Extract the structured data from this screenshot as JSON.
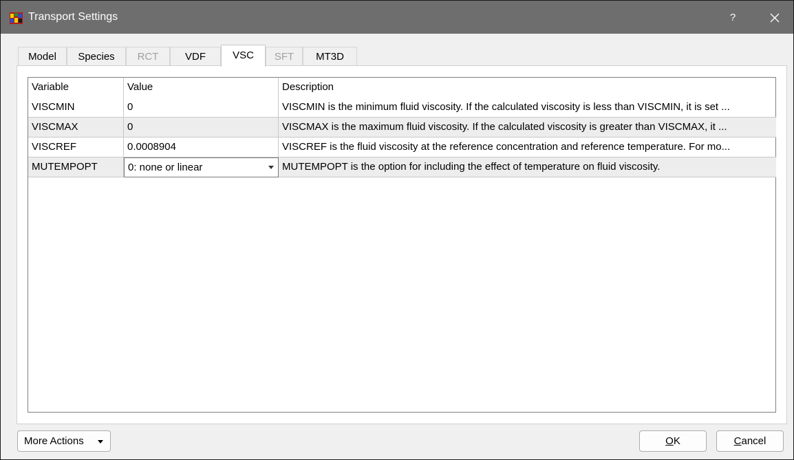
{
  "window": {
    "title": "Transport Settings",
    "help_label": "?",
    "icon": "app-icon",
    "colors": {
      "titlebar": "#6e6e6e",
      "alt_row": "#ededed"
    }
  },
  "tabs": [
    {
      "label": "Model",
      "enabled": true,
      "active": false
    },
    {
      "label": "Species",
      "enabled": true,
      "active": false
    },
    {
      "label": "RCT",
      "enabled": false,
      "active": false
    },
    {
      "label": "VDF",
      "enabled": true,
      "active": false
    },
    {
      "label": "VSC",
      "enabled": true,
      "active": true
    },
    {
      "label": "SFT",
      "enabled": false,
      "active": false
    },
    {
      "label": "MT3D",
      "enabled": true,
      "active": false
    }
  ],
  "table": {
    "columns": [
      "Variable",
      "Value",
      "Description"
    ],
    "rows": [
      {
        "variable": "VISCMIN",
        "value": "0",
        "description": "VISCMIN is the minimum fluid viscosity. If the calculated viscosity is less than VISCMIN, it is set ..."
      },
      {
        "variable": "VISCMAX",
        "value": "0",
        "description": "VISCMAX is the maximum fluid viscosity. If the calculated viscosity is greater than VISCMAX, it ..."
      },
      {
        "variable": "VISCREF",
        "value": "0.0008904",
        "description": "VISCREF is the fluid viscosity at the reference concentration and reference temperature. For mo..."
      },
      {
        "variable": "MUTEMPOPT",
        "value": "0: none or linear",
        "description": "MUTEMPOPT is the option for including the effect of temperature on fluid viscosity."
      }
    ]
  },
  "buttons": {
    "more_actions": "More Actions",
    "ok_label": "OK",
    "cancel_label": "Cancel",
    "ok_mnemonic": "O",
    "ok_rest": "K",
    "cancel_mnemonic": "C",
    "cancel_rest": "ancel"
  }
}
